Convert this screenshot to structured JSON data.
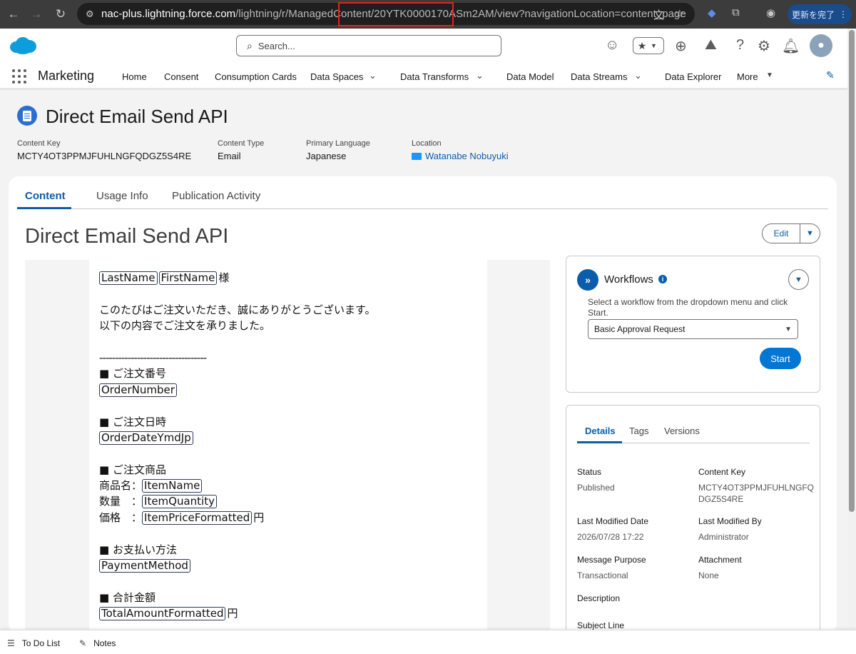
{
  "browser": {
    "url_host": "nac-plus.lightning.force.com",
    "url_path": "/lightning/r/ManagedContent/20YTK0000170ASm2AM/view?navigationLocation=content_page",
    "update_label": "更新を完了"
  },
  "header": {
    "search_placeholder": "Search..."
  },
  "appnav": {
    "app_name": "Marketing",
    "items": [
      "Home",
      "Consent",
      "Consumption Cards",
      "Data Spaces",
      "Data Transforms",
      "Data Model",
      "Data Streams",
      "Data Explorer",
      "More"
    ]
  },
  "record": {
    "title": "Direct Email Send API",
    "fields": [
      {
        "label": "Content Key",
        "value": "MCTY4OT3PPMJFUHLNGFQDGZ5S4RE"
      },
      {
        "label": "Content Type",
        "value": "Email"
      },
      {
        "label": "Primary Language",
        "value": "Japanese"
      },
      {
        "label": "Location",
        "value": "Watanabe Nobuyuki"
      }
    ]
  },
  "tabs": [
    "Content",
    "Usage Info",
    "Publication Activity"
  ],
  "content": {
    "title": "Direct Email Send API",
    "edit_label": "Edit"
  },
  "email": {
    "tokens": {
      "last_name": "LastName",
      "first_name": "FirstName",
      "order_number": "OrderNumber",
      "order_date": "OrderDateYmdJp",
      "item_name": "ItemName",
      "item_quantity": "ItemQuantity",
      "item_price": "ItemPriceFormatted",
      "payment_method": "PaymentMethod",
      "total_amount": "TotalAmountFormatted"
    },
    "honorific": "様",
    "greeting_1": "このたびはご注文いただき、誠にありがとうございます。",
    "greeting_2": "以下の内容でご注文を承りました。",
    "divider": "----------------------------------",
    "sec_order_number": "■ ご注文番号",
    "sec_order_date": "■ ご注文日時",
    "sec_items": "■ ご注文商品",
    "label_item_name": "商品名：",
    "label_quantity": "数量　：",
    "label_price": "価格　：",
    "yen": "円",
    "sec_payment": "■ お支払い方法",
    "sec_total": "■ 合計金額"
  },
  "workflows": {
    "title": "Workflows",
    "description": "Select a workflow from the dropdown menu and click Start.",
    "selected": "Basic Approval Request",
    "start_label": "Start"
  },
  "details": {
    "tabs": [
      "Details",
      "Tags",
      "Versions"
    ],
    "fields": {
      "status": {
        "label": "Status",
        "value": "Published"
      },
      "content_key": {
        "label": "Content Key",
        "value": "MCTY4OT3PPMJFUHLNGFQ DGZ5S4RE"
      },
      "last_modified_date": {
        "label": "Last Modified Date",
        "value": "2026/07/28 17:22"
      },
      "last_modified_by": {
        "label": "Last Modified By",
        "value": "Administrator"
      },
      "message_purpose": {
        "label": "Message Purpose",
        "value": "Transactional"
      },
      "attachment": {
        "label": "Attachment",
        "value": "None"
      },
      "description": {
        "label": "Description"
      },
      "subject_line": {
        "label": "Subject Line"
      }
    }
  },
  "utility_bar": {
    "todo": "To Do List",
    "notes": "Notes"
  }
}
